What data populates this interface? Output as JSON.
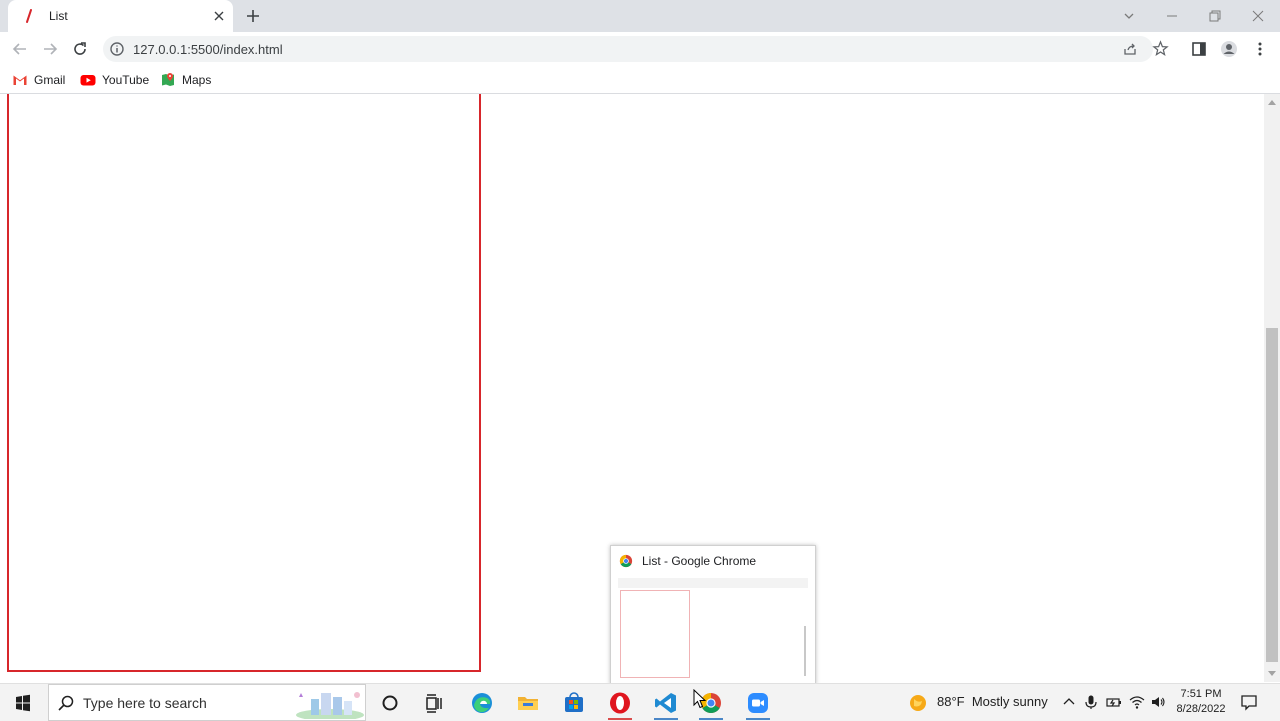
{
  "browser": {
    "tab": {
      "title": "List",
      "favicon": "red-slash-favicon"
    },
    "new_tab_icon": "plus-icon",
    "address_bar": {
      "url": "127.0.0.1:5500/index.html",
      "info_icon": "info-icon"
    },
    "bookmarks": [
      {
        "label": "Gmail",
        "icon": "gmail-icon"
      },
      {
        "label": "YouTube",
        "icon": "youtube-icon"
      },
      {
        "label": "Maps",
        "icon": "maps-icon"
      }
    ]
  },
  "page": {
    "list_border_color": "#d7262b"
  },
  "preview": {
    "title": "List - Google Chrome",
    "icon": "chrome-icon"
  },
  "taskbar": {
    "search_placeholder": "Type here to search",
    "weather": {
      "temperature": "88°F",
      "condition": "Mostly sunny",
      "icon": "sun-icon"
    },
    "clock": {
      "time": "7:51 PM",
      "date": "8/28/2022"
    },
    "apps": [
      "cortana-icon",
      "task-view-icon",
      "edge-icon",
      "file-explorer-icon",
      "store-icon",
      "opera-icon",
      "vscode-icon",
      "chrome-icon",
      "zoom-icon"
    ]
  }
}
